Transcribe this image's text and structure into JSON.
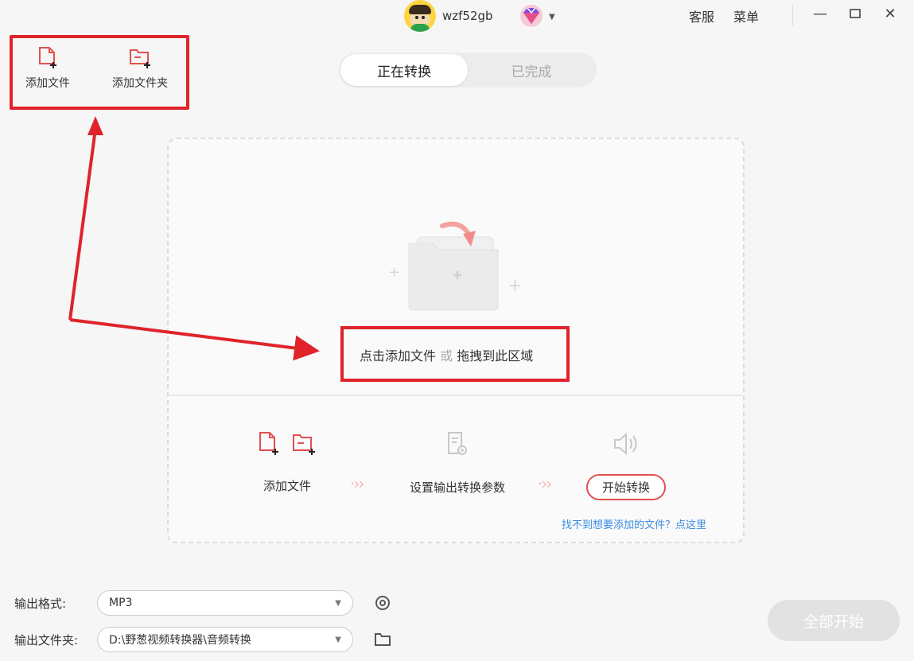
{
  "user": {
    "name": "wzf52gb"
  },
  "header": {
    "links": [
      "客服",
      "菜单"
    ],
    "window_controls": [
      "minimize-icon",
      "maximize-icon",
      "close-icon"
    ]
  },
  "toolbar": {
    "add_file_label": "添加文件",
    "add_folder_label": "添加文件夹"
  },
  "tabs": [
    {
      "label": "正在转换",
      "active": true
    },
    {
      "label": "已完成",
      "active": false
    }
  ],
  "drop_area": {
    "prompt_click": "点击添加文件",
    "prompt_or": "或",
    "prompt_drag": "拖拽到此区域"
  },
  "steps": {
    "step1_label": "添加文件",
    "step2_label": "设置输出转换参数",
    "step3_label": "开始转换"
  },
  "help_link": "找不到想要添加的文件？点这里",
  "output": {
    "format_label": "输出格式:",
    "format_value": "MP3",
    "folder_label": "输出文件夹:",
    "folder_value": "D:\\野葱视频转换器\\音频转换"
  },
  "start_all_label": "全部开始",
  "colors": {
    "accent": "#e0514f",
    "annotation": "#e0232b",
    "link": "#3b8ce3"
  }
}
